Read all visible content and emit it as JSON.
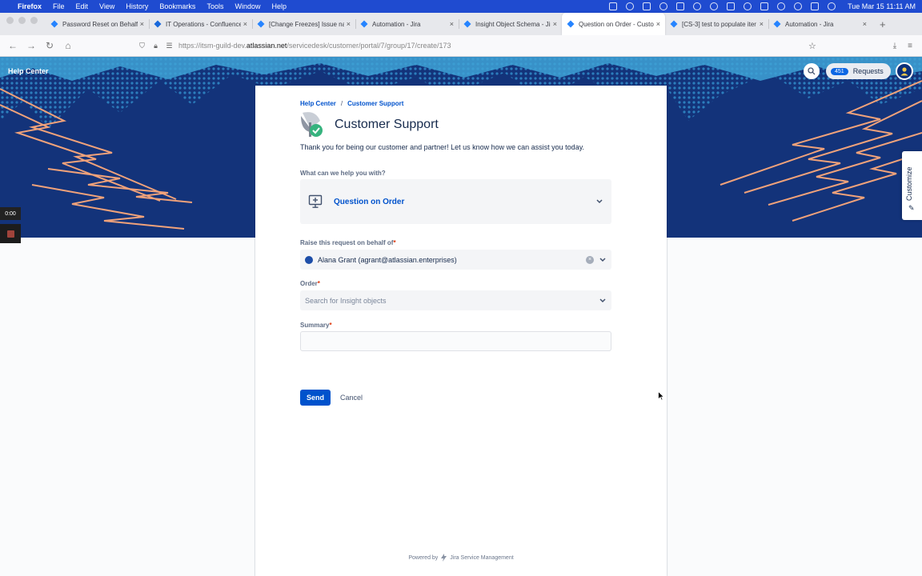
{
  "menubar": {
    "app": "Firefox",
    "items": [
      "File",
      "Edit",
      "View",
      "History",
      "Bookmarks",
      "Tools",
      "Window",
      "Help"
    ],
    "clock": "Tue Mar 15  11:11 AM"
  },
  "tabs": [
    {
      "title": "Password Reset on Behalf o",
      "icon": "jira-icon"
    },
    {
      "title": "IT Operations - Confluence",
      "icon": "confluence-icon"
    },
    {
      "title": "[Change Freezes] Issue navi",
      "icon": "jira-icon"
    },
    {
      "title": "Automation - Jira",
      "icon": "jira-icon"
    },
    {
      "title": "Insight Object Schema - Jir",
      "icon": "jira-icon"
    },
    {
      "title": "Question on Order - Custon",
      "icon": "jira-icon",
      "active": true
    },
    {
      "title": "[CS-3] test to populate iter",
      "icon": "jira-icon"
    },
    {
      "title": "Automation - Jira",
      "icon": "jira-icon"
    }
  ],
  "url": {
    "prefix": "https://itsm-guild-dev.",
    "host": "atlassian.net",
    "path": "/servicedesk/customer/portal/7/group/17/create/173"
  },
  "header": {
    "help_center": "Help Center",
    "requests_count": "451",
    "requests_label": "Requests"
  },
  "customize_label": "Customize",
  "recorder": {
    "time": "0:00"
  },
  "card": {
    "breadcrumb": {
      "root": "Help Center",
      "separator": "/",
      "current": "Customer Support"
    },
    "title": "Customer Support",
    "description": "Thank you for being our customer and partner! Let us know how we can assist you today.",
    "request_type": {
      "label": "What can we help you with?",
      "value": "Question on Order"
    },
    "on_behalf": {
      "label": "Raise this request on behalf of",
      "required": "*",
      "value": "Alana Grant (agrant@atlassian.enterprises)"
    },
    "order": {
      "label": "Order",
      "required": "*",
      "placeholder": "Search for Insight objects"
    },
    "summary": {
      "label": "Summary",
      "required": "*",
      "value": ""
    },
    "send": "Send",
    "cancel": "Cancel",
    "powered_prefix": "Powered by",
    "powered_product": "Jira Service Management"
  },
  "colors": {
    "brand": "#0052cc",
    "hero": "#14337a",
    "menubar": "#1f4bd0"
  }
}
